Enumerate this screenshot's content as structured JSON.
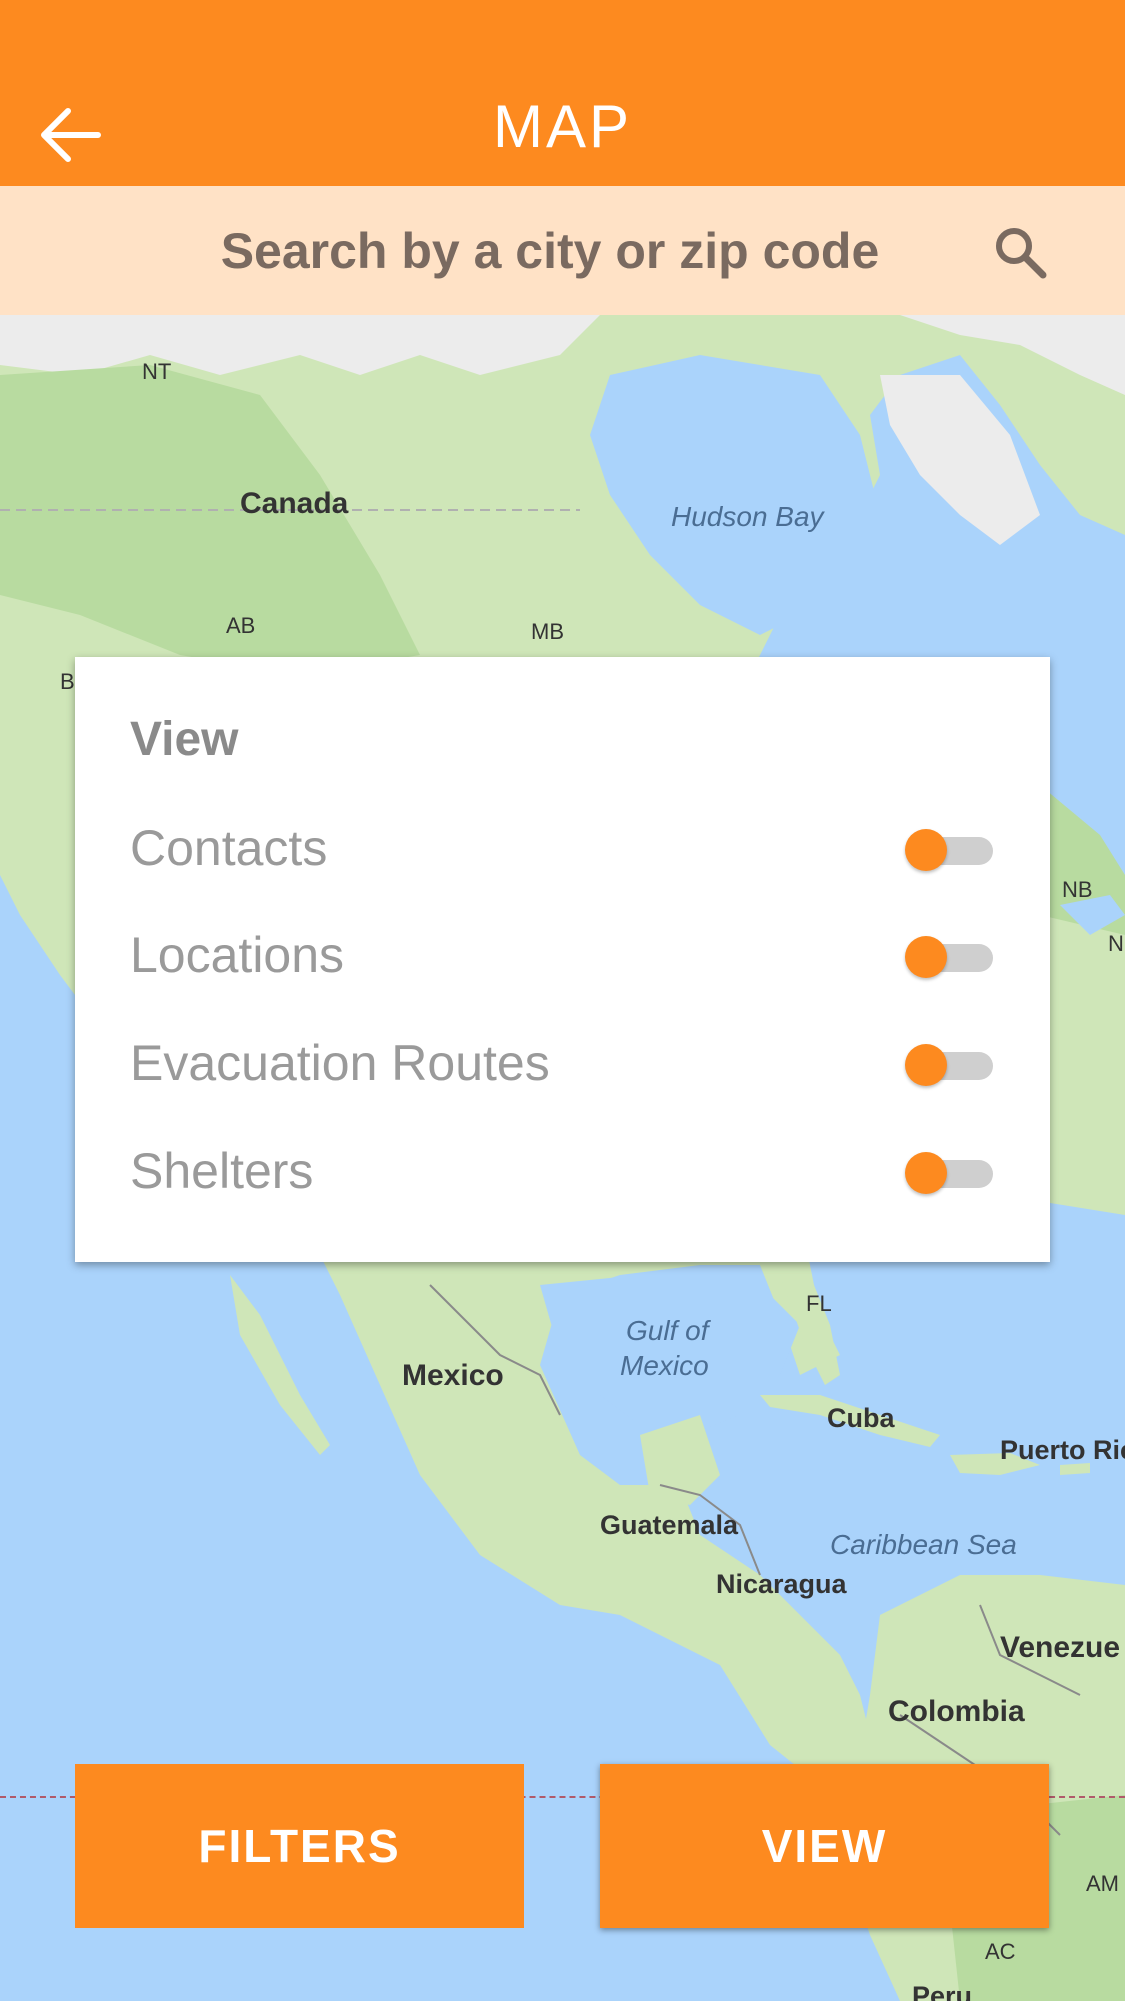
{
  "header": {
    "title": "MAP",
    "back_icon": "arrow-left-icon",
    "background": "#fd8a1f"
  },
  "search": {
    "placeholder": "Search by a city or zip code",
    "icon": "search-icon",
    "background": "#ffe2c6"
  },
  "map": {
    "labels": {
      "nt": "NT",
      "canada": "Canada",
      "hudson_bay": "Hudson Bay",
      "ab": "AB",
      "mb": "MB",
      "b": "B",
      "nb": "NB",
      "n": "N",
      "fl": "FL",
      "gulf_of": "Gulf of",
      "mexico_water": "Mexico",
      "mexico": "Mexico",
      "cuba": "Cuba",
      "puerto_rico": "Puerto Ric",
      "guatemala": "Guatemala",
      "caribbean_sea": "Caribbean Sea",
      "nicaragua": "Nicaragua",
      "venezuela": "Venezue",
      "colombia": "Colombia",
      "am": "AM",
      "ac": "AC",
      "peru": "Peru"
    }
  },
  "view_panel": {
    "title": "View",
    "items": [
      {
        "label": "Contacts",
        "on": false
      },
      {
        "label": "Locations",
        "on": false
      },
      {
        "label": "Evacuation Routes",
        "on": false
      },
      {
        "label": "Shelters",
        "on": false
      }
    ]
  },
  "buttons": {
    "filters": "FILTERS",
    "view": "VIEW"
  },
  "accent": "#fd8a1f"
}
